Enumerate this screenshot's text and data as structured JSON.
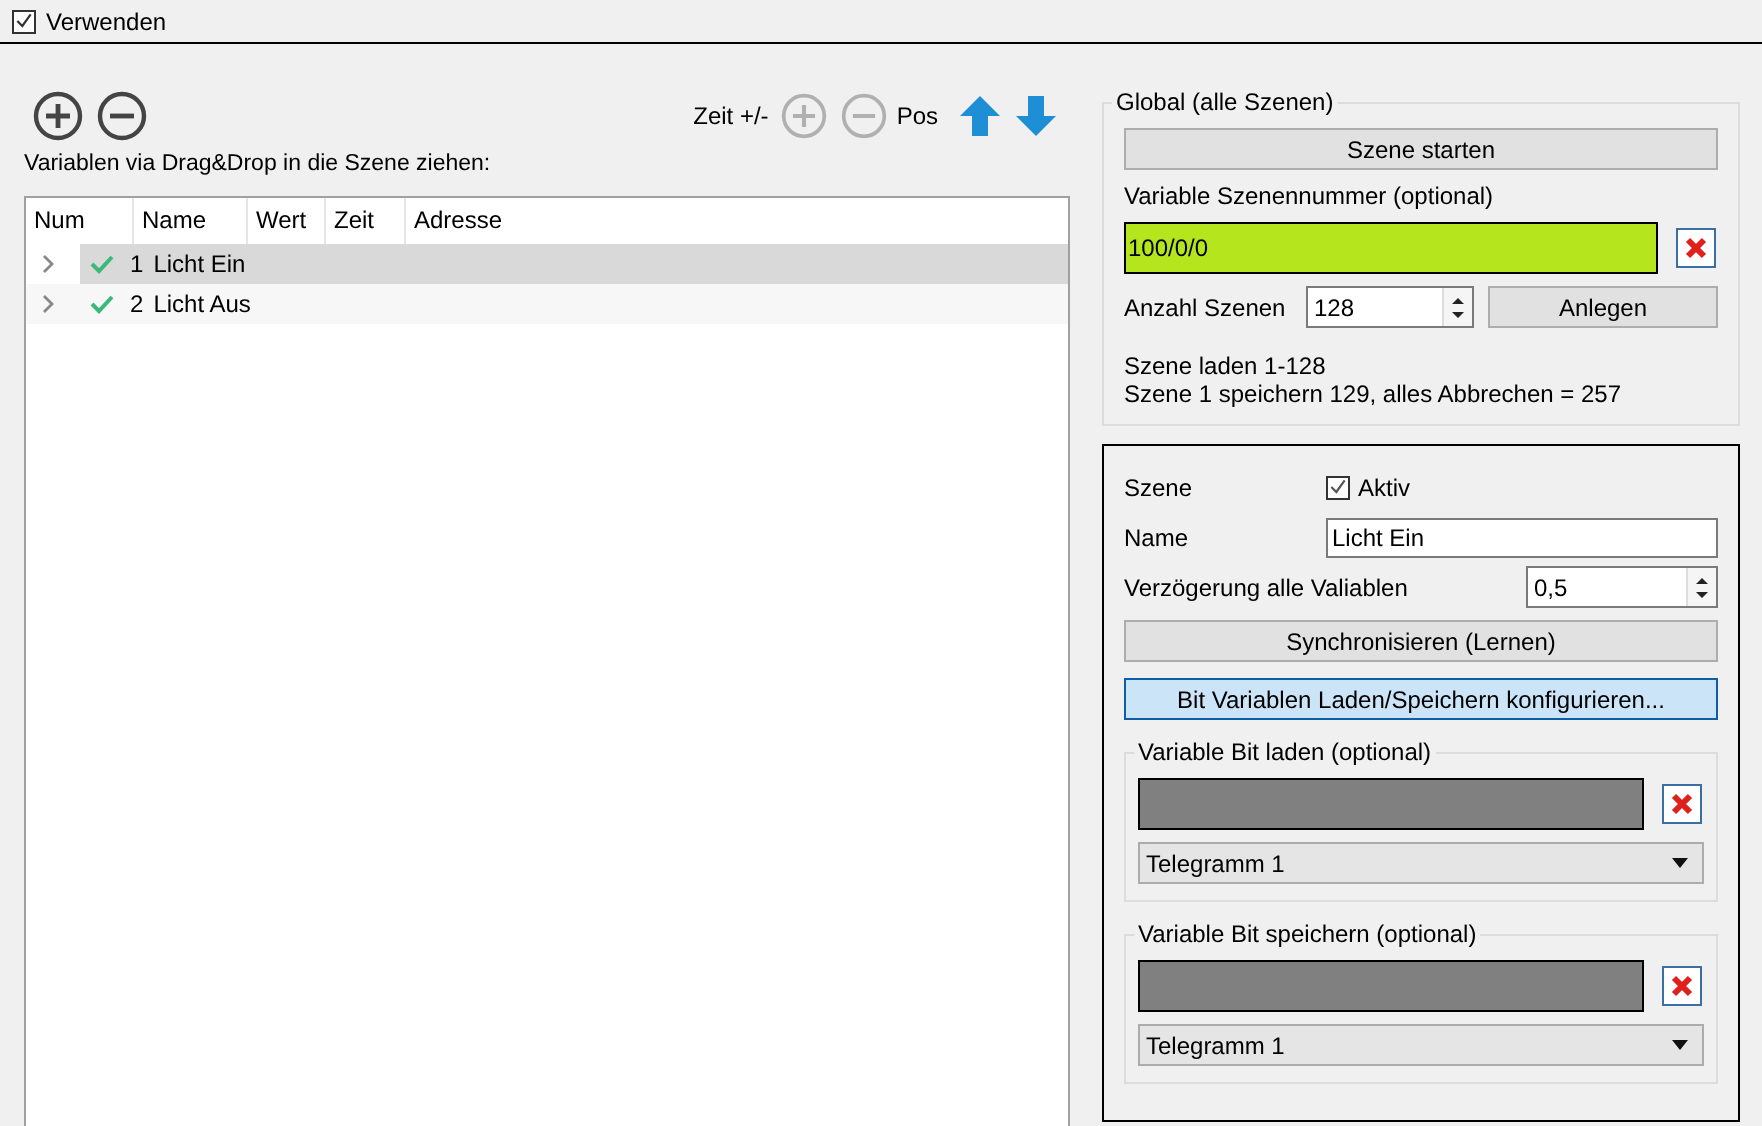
{
  "use_checkbox": {
    "label": "Verwenden",
    "checked": true
  },
  "toolbar": {
    "time_label": "Zeit +/-",
    "pos_label": "Pos",
    "time_buttons_disabled": true
  },
  "hint": "Variablen via Drag&Drop in die Szene ziehen:",
  "table": {
    "columns": [
      "Num",
      "Name",
      "Wert",
      "Zeit",
      "Adresse"
    ],
    "rows": [
      {
        "num": "1",
        "name": "Licht Ein",
        "selected": true,
        "expanded": false
      },
      {
        "num": "2",
        "name": "Licht Aus",
        "selected": false,
        "expanded": false
      }
    ]
  },
  "global": {
    "title": "Global (alle Szenen)",
    "start_button": "Szene starten",
    "scene_var_label": "Variable Szenennummer (optional)",
    "scene_var_value": "100/0/0",
    "count_label": "Anzahl Szenen",
    "count_value": "128",
    "create_button": "Anlegen",
    "info_lines": [
      "Szene laden 1-128",
      "Szene 1 speichern 129, alles Abbrechen = 257"
    ]
  },
  "scene": {
    "scene_label": "Szene",
    "active_label": "Aktiv",
    "active": true,
    "name_label": "Name",
    "name_value": "Licht Ein",
    "delay_label": "Verzögerung alle Valiablen",
    "delay_value": "0,5",
    "sync_button": "Synchronisieren (Lernen)",
    "config_button": "Bit Variablen Laden/Speichern konfigurieren...",
    "groups": [
      {
        "title": "Variable Bit laden (optional)",
        "telegram": "Telegramm 1"
      },
      {
        "title": "Variable Bit speichern (optional)",
        "telegram": "Telegramm 1"
      }
    ]
  }
}
